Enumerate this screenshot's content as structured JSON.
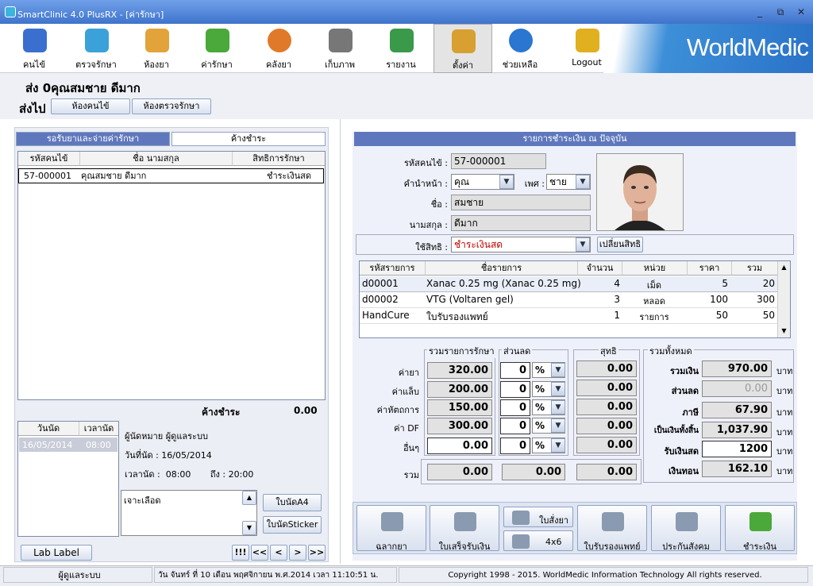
{
  "window": {
    "title": "SmartClinic 4.0 PlusRX - [ค่ารักษา]",
    "min": "_",
    "max": "⧉",
    "close": "✕"
  },
  "toolbar": {
    "items": [
      {
        "label": "คนไข้",
        "icon": "patient-book-icon",
        "color": "#3a6fd0"
      },
      {
        "label": "ตรวจรักษา",
        "icon": "doctor-icon",
        "color": "#3aa2d8"
      },
      {
        "label": "ห้องยา",
        "icon": "pharmacy-icon",
        "color": "#e2a33a"
      },
      {
        "label": "ค่ารักษา",
        "icon": "money-icon",
        "color": "#4ba83a"
      },
      {
        "label": "คลังยา",
        "icon": "capsule-icon",
        "color": "#e07a2a"
      },
      {
        "label": "เก็บภาพ",
        "icon": "camera-icon",
        "color": "#777"
      },
      {
        "label": "รายงาน",
        "icon": "bar-chart-icon",
        "color": "#3a9a4a"
      },
      {
        "label": "ตั้งค่า",
        "icon": "settings-tools-icon",
        "color": "#d8a030"
      },
      {
        "label": "ช่วยเหลือ",
        "icon": "help-icon",
        "color": "#2a76d0"
      },
      {
        "label": "Logout",
        "icon": "lock-icon",
        "color": "#e0b020"
      }
    ],
    "brand": "WorldMedic"
  },
  "header": {
    "patient": "ส่ง  0คุณสมชาย ดีมาก",
    "send_to": "ส่งไป",
    "btn1": "ห้องคนไข้",
    "btn2": "ห้องตรวจรักษา"
  },
  "left": {
    "tab1": "รอรับยาและจ่ายค่ารักษา",
    "tab2": "ค้างชำระ",
    "cols": [
      "รหัสคนไข้",
      "ชื่อ นามสกุล",
      "สิทธิการรักษา"
    ],
    "rows": [
      {
        "id": "57-000001",
        "name": "คุณสมชาย ดีมาก",
        "right": "ชำระเงินสด"
      }
    ],
    "outstanding_label": "ค้างชำระ",
    "outstanding_value": "0.00",
    "appt_cols": [
      "วันนัด",
      "เวลานัด"
    ],
    "appt_row": {
      "date": "16/05/2014",
      "time": "08:00"
    },
    "appt_by": "ผู้นัดหมาย ผู้ดูแลระบบ",
    "appt_date": "วันที่นัด :  16/05/2014",
    "appt_time": "เวลานัด :  08:00       ถึง : 20:00",
    "appt_note": "เจาะเลือด",
    "btn_a4": "ใบนัดA4",
    "btn_sticker": "ใบนัดSticker",
    "btn_lab": "Lab Label",
    "nav": [
      "!!!",
      "<<",
      "<",
      ">",
      ">>"
    ]
  },
  "right": {
    "title": "รายการชำระเงิน ณ ปัจจุบัน",
    "lbl_id": "รหัสคนไข้ :",
    "id": "57-000001",
    "lbl_prefix": "คำนำหน้า :",
    "prefix": "คุณ",
    "lbl_sex": "เพศ :",
    "sex": "ชาย",
    "lbl_name": "ชื่อ :",
    "name": "สมชาย",
    "lbl_surname": "นามสกุล :",
    "surname": "ดีมาก",
    "lbl_right": "ใช้สิทธิ :",
    "right": "ชำระเงินสด",
    "btn_change": "เปลี่ยนสิทธิ",
    "items_cols": [
      "รหัสรายการ",
      "ชื่อรายการ",
      "จำนวน",
      "หน่วย",
      "ราคา",
      "รวม"
    ],
    "items": [
      {
        "code": "d00001",
        "name": "Xanac 0.25 mg (Xanac 0.25 mg)",
        "qty": "4",
        "unit": "เม็ด",
        "price": "5",
        "total": "20"
      },
      {
        "code": "d00002",
        "name": "VTG (Voltaren gel)",
        "qty": "3",
        "unit": "หลอด",
        "price": "100",
        "total": "300"
      },
      {
        "code": "HandCure",
        "name": "ใบรับรองแพทย์",
        "qty": "1",
        "unit": "รายการ",
        "price": "50",
        "total": "50"
      }
    ],
    "grp_cost": "รวมรายการรักษา",
    "grp_disc": "ส่วนลด",
    "grp_right": "สุทธิ",
    "grp_total": "รวมทั้งหมด",
    "cost_rows": [
      {
        "label": "ค่ายา",
        "value": "320.00"
      },
      {
        "label": "ค่าแล็บ",
        "value": "200.00"
      },
      {
        "label": "ค่าหัตถการ",
        "value": "150.00"
      },
      {
        "label": "ค่า DF",
        "value": "300.00"
      },
      {
        "label": "อื่นๆ",
        "value": "0.00"
      }
    ],
    "disc_value": "0",
    "disc_unit": "%",
    "net_values": [
      "0.00",
      "0.00",
      "0.00",
      "0.00",
      "0.00"
    ],
    "sum_label": "รวม",
    "sum_cost": "0.00",
    "sum_disc": "0.00",
    "sum_net": "0.00",
    "totals": [
      {
        "label": "รวมเงิน",
        "value": "970.00",
        "unit": "บาท"
      },
      {
        "label": "ส่วนลด",
        "value": "0.00",
        "unit": "บาท"
      },
      {
        "label": "ภาษี",
        "value": "67.90",
        "unit": "บาท"
      },
      {
        "label": "เป็นเงินทั้งสิ้น",
        "value": "1,037.90",
        "unit": "บาท"
      },
      {
        "label": "รับเงินสด",
        "value": "1200",
        "unit": "บาท"
      },
      {
        "label": "เงินทอน",
        "value": "162.10",
        "unit": "บาท"
      }
    ],
    "buttons": [
      "ฉลากยา",
      "ใบเสร็จรับเงิน",
      "ใบสั่งยา",
      "4x6",
      "ใบรับรองแพทย์",
      "ประกันสังคม",
      "ชำระเงิน"
    ]
  },
  "status": {
    "user": "ผู้ดูแลระบบ",
    "date": "วัน จันทร์ ที่ 10 เดือน พฤศจิกายน พ.ศ.2014 เวลา 11:10:51 น.",
    "copyright": "Copyright 1998 - 2015. WorldMedic Information  Technology All rights reserved."
  }
}
